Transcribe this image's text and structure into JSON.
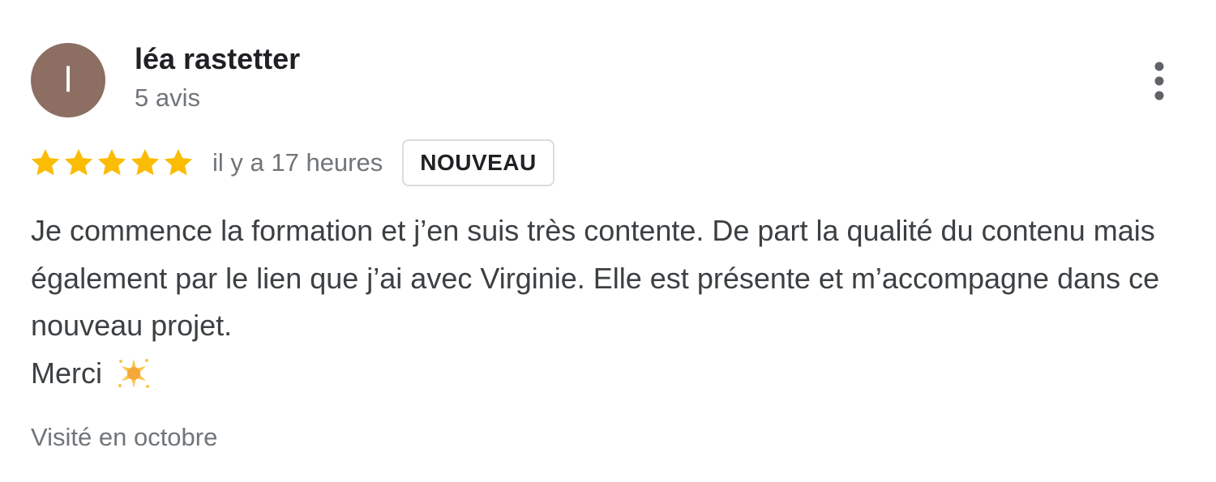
{
  "review": {
    "author": {
      "initial": "l",
      "name": "léa rastetter",
      "meta": "5 avis",
      "avatar_color": "#8d6e63"
    },
    "rating": {
      "stars": 5,
      "max_stars": 5,
      "star_color": "#fbbc04",
      "time_ago": "il y a 17 heures",
      "badge": "NOUVEAU"
    },
    "text": "Je commence la formation et j’en suis très contente. De part la qualité du contenu mais également par le lien que j’ai avec Virginie. Elle est présente et m’accompagne dans ce nouveau projet.",
    "thanks": "Merci",
    "emoji_icon": "glowing-star-icon",
    "visit": "Visité en octobre",
    "menu_icon": "more-vert-icon"
  }
}
